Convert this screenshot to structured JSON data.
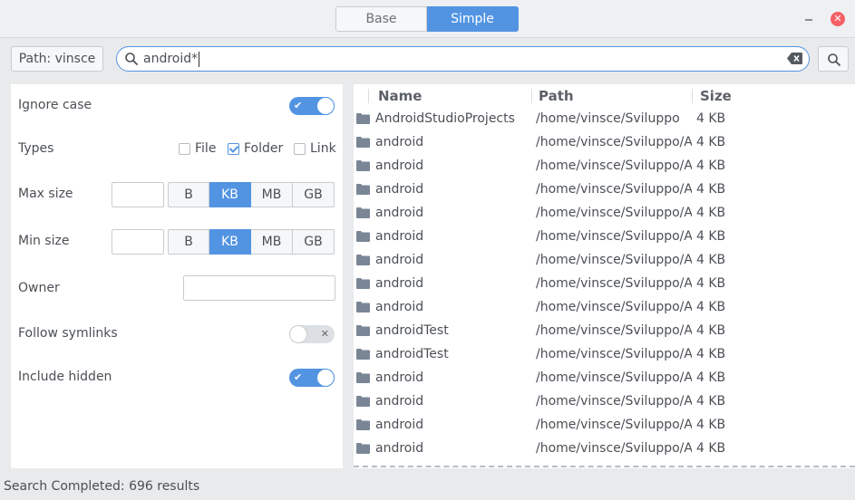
{
  "titlebar": {
    "tabs": [
      {
        "label": "Base",
        "active": false
      },
      {
        "label": "Simple",
        "active": true
      }
    ],
    "minimize_icon": "minimize-icon",
    "close_icon": "close-icon",
    "close_color": "#f46067"
  },
  "toolbar": {
    "path_label": "Path: vinsce",
    "search_value": "android*",
    "search_icon": "search-icon",
    "clear_icon": "clear-icon"
  },
  "options": {
    "ignore_case": {
      "label": "Ignore case",
      "on": true
    },
    "types": {
      "label": "Types",
      "items": [
        {
          "label": "File",
          "checked": false
        },
        {
          "label": "Folder",
          "checked": true
        },
        {
          "label": "Link",
          "checked": false
        }
      ]
    },
    "max_size": {
      "label": "Max size",
      "value": "",
      "units": [
        "B",
        "KB",
        "MB",
        "GB"
      ],
      "selected": "KB"
    },
    "min_size": {
      "label": "Min size",
      "value": "",
      "units": [
        "B",
        "KB",
        "MB",
        "GB"
      ],
      "selected": "KB"
    },
    "owner": {
      "label": "Owner",
      "value": ""
    },
    "follow_symlinks": {
      "label": "Follow symlinks",
      "on": false
    },
    "include_hidden": {
      "label": "Include hidden",
      "on": true
    }
  },
  "results": {
    "columns": [
      "Name",
      "Path",
      "Size"
    ],
    "rows": [
      {
        "name": "AndroidStudioProjects",
        "path": "/home/vinsce/Sviluppo",
        "size": "4 KB"
      },
      {
        "name": "android",
        "path": "/home/vinsce/Sviluppo/Android",
        "size": "4 KB"
      },
      {
        "name": "android",
        "path": "/home/vinsce/Sviluppo/Android",
        "size": "4 KB"
      },
      {
        "name": "android",
        "path": "/home/vinsce/Sviluppo/Android",
        "size": "4 KB"
      },
      {
        "name": "android",
        "path": "/home/vinsce/Sviluppo/Android",
        "size": "4 KB"
      },
      {
        "name": "android",
        "path": "/home/vinsce/Sviluppo/Android",
        "size": "4 KB"
      },
      {
        "name": "android",
        "path": "/home/vinsce/Sviluppo/Android",
        "size": "4 KB"
      },
      {
        "name": "android",
        "path": "/home/vinsce/Sviluppo/Android",
        "size": "4 KB"
      },
      {
        "name": "android",
        "path": "/home/vinsce/Sviluppo/Android",
        "size": "4 KB"
      },
      {
        "name": "androidTest",
        "path": "/home/vinsce/Sviluppo/Android",
        "size": "4 KB"
      },
      {
        "name": "androidTest",
        "path": "/home/vinsce/Sviluppo/Android",
        "size": "4 KB"
      },
      {
        "name": "android",
        "path": "/home/vinsce/Sviluppo/Android",
        "size": "4 KB"
      },
      {
        "name": "android",
        "path": "/home/vinsce/Sviluppo/Android",
        "size": "4 KB"
      },
      {
        "name": "android",
        "path": "/home/vinsce/Sviluppo/Android",
        "size": "4 KB"
      },
      {
        "name": "android",
        "path": "/home/vinsce/Sviluppo/Android",
        "size": "4 KB"
      }
    ],
    "row_icon": "folder-icon",
    "icon_color": "#7a8696"
  },
  "status": {
    "text": "Search Completed: 696 results"
  },
  "colors": {
    "accent": "#5294e2",
    "background": "#e9eaec",
    "panel": "#ffffff",
    "text": "#4b4f55"
  }
}
